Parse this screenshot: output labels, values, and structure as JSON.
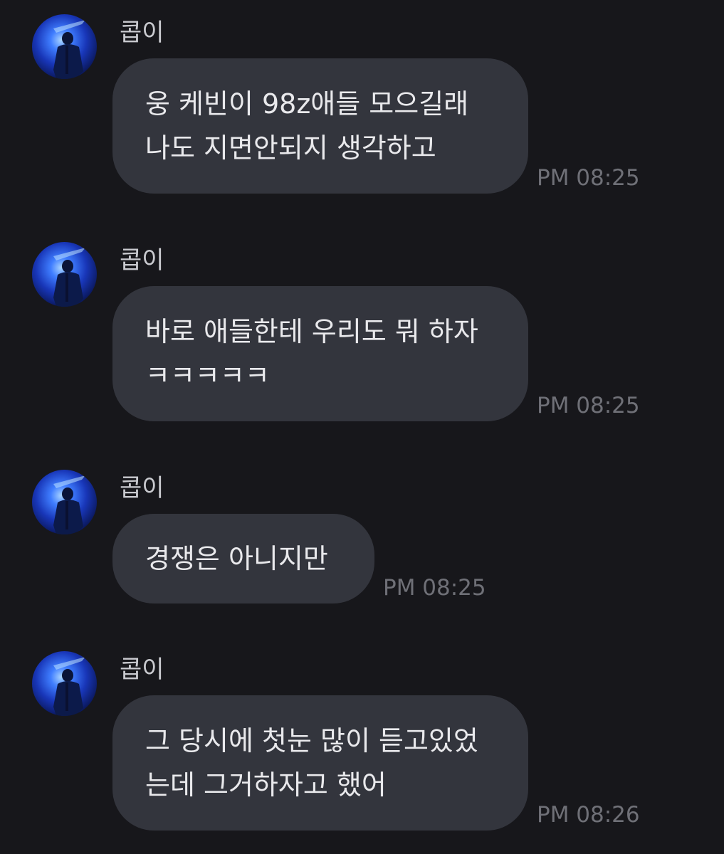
{
  "messages": [
    {
      "sender": "콥이",
      "lines": [
        "웅 케빈이 98z애들 모으길래",
        "나도 지면안되지 생각하고"
      ],
      "time": "PM 08:25"
    },
    {
      "sender": "콥이",
      "lines": [
        "바로 애들한테 우리도 뭐 하자",
        "ㅋㅋㅋㅋㅋ"
      ],
      "time": "PM 08:25"
    },
    {
      "sender": "콥이",
      "lines": [
        "경쟁은 아니지만"
      ],
      "time": "PM 08:25"
    },
    {
      "sender": "콥이",
      "lines": [
        "그 당시에 첫눈 많이 듣고있었",
        "는데 그거하자고 했어"
      ],
      "time": "PM 08:26"
    }
  ],
  "colors": {
    "background": "#17171b",
    "bubble": "#33353d",
    "text": "#e9e9ec",
    "sender": "#c9cacf",
    "timestamp": "#6f7077"
  },
  "icons": {
    "avatar": "profile-photo-icon"
  }
}
